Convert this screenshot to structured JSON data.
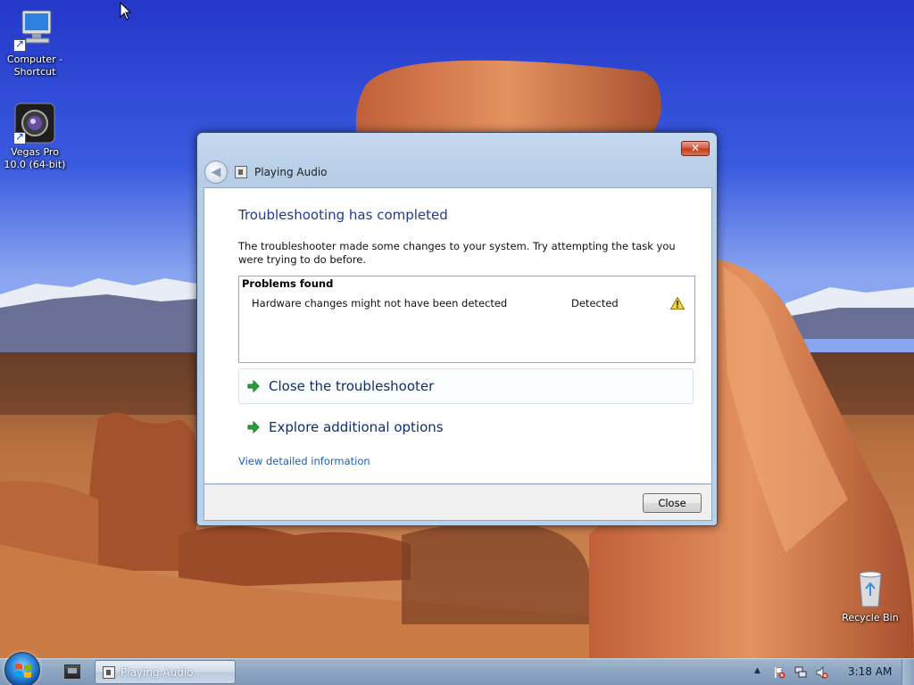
{
  "desktop": {
    "icons": [
      {
        "label_line1": "Computer -",
        "label_line2": "Shortcut"
      },
      {
        "label_line1": "Vegas Pro",
        "label_line2": "10.0 (64-bit)"
      },
      {
        "label_line1": "Recycle Bin",
        "label_line2": ""
      }
    ]
  },
  "dialog": {
    "title": "Playing Audio",
    "close_glyph": "✕",
    "back_glyph": "◀",
    "heading": "Troubleshooting has completed",
    "description": "The troubleshooter made some changes to your system. Try attempting the task you were trying to do before.",
    "problems": {
      "title": "Problems found",
      "rows": [
        {
          "name": "Hardware changes might not have been detected",
          "status": "Detected",
          "icon": "warning-icon"
        }
      ]
    },
    "links": [
      {
        "label": "Close the troubleshooter",
        "icon": "green-arrow-icon"
      },
      {
        "label": "Explore additional options",
        "icon": "green-arrow-icon"
      }
    ],
    "detail_link": "View detailed information",
    "close_button": "Close"
  },
  "taskbar": {
    "task_label": "Playing Audio",
    "tray_up_glyph": "▲",
    "clock": "3:18 AM"
  },
  "colors": {
    "heading": "#1f3b8c",
    "link": "#1c5fb8",
    "taskbar": "#8ea6c2"
  }
}
